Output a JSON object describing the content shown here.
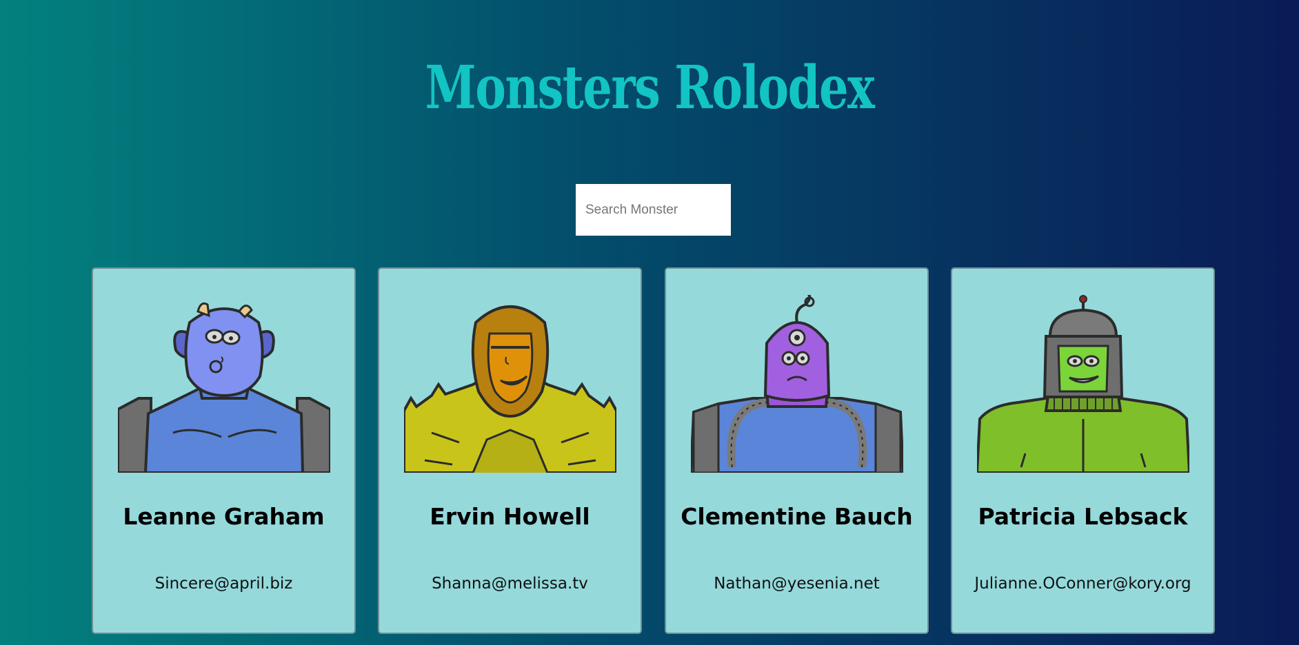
{
  "app": {
    "title": "Monsters Rolodex"
  },
  "search": {
    "placeholder": "Search Monster",
    "value": ""
  },
  "cards": [
    {
      "name": "Leanne Graham",
      "email": "Sincere@april.biz",
      "avatar_icon": "blue-horned-monster-avatar"
    },
    {
      "name": "Ervin Howell",
      "email": "Shanna@melissa.tv",
      "avatar_icon": "orange-hooded-monster-avatar"
    },
    {
      "name": "Clementine Bauch",
      "email": "Nathan@yesenia.net",
      "avatar_icon": "purple-cyclops-monster-avatar"
    },
    {
      "name": "Patricia Lebsack",
      "email": "Julianne.OConner@kory.org",
      "avatar_icon": "green-robot-monster-avatar"
    }
  ],
  "colors": {
    "title": "#12c4c4",
    "card_background": "#95d9db",
    "background_start": "#03817f",
    "background_end": "#0a1b56"
  }
}
